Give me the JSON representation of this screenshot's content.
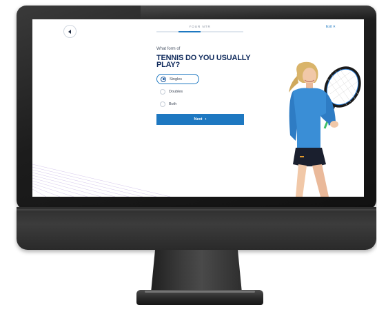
{
  "header": {
    "step_label": "YOUR NTR",
    "exit_label": "Exit",
    "exit_icon": "close-x-icon",
    "back_icon": "chevron-left-icon",
    "progress": 0.25
  },
  "question": {
    "eyebrow": "What form of",
    "title": "TENNIS DO YOU USUALLY PLAY?"
  },
  "options": [
    {
      "label": "Singles",
      "selected": true
    },
    {
      "label": "Doubles",
      "selected": false
    },
    {
      "label": "Both",
      "selected": false
    }
  ],
  "next_button": {
    "label": "Next",
    "icon": "arrow-right-icon"
  },
  "colors": {
    "accent": "#1e78c1",
    "heading": "#0f2a5c",
    "shirt": "#3a8ed6",
    "skirt": "#1a1f2e"
  }
}
